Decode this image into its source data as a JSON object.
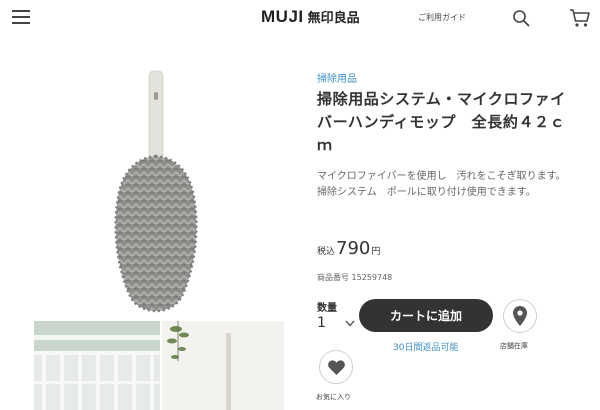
{
  "header": {
    "logo_text": "MUJI",
    "logo_jp": "無印良品",
    "guide_link": "ご利用ガイド",
    "icons": [
      "menu-icon",
      "search-icon",
      "cart-icon"
    ]
  },
  "product": {
    "category": "掃除用品",
    "title": "掃除用品システム・マイクロファイバーハンディモップ　全長約４２ｃｍ",
    "description": "マイクロファイバーを使用し　汚れをこそぎ取ります。掃除システム　ポールに取り付け使用できます。",
    "price_prefix": "税込",
    "price_value": "790",
    "price_unit": "円",
    "item_number_label": "商品番号",
    "item_number": "15259748"
  },
  "purchase": {
    "quantity_label": "数量",
    "quantity_value": "1",
    "add_to_cart": "カートに追加",
    "returns_note": "30日間返品可能",
    "store_stock": "店舗在庫",
    "favorite": "お気に入り"
  },
  "colors": {
    "accent_blue": "#3f8fc9",
    "button_dark": "#333333"
  }
}
